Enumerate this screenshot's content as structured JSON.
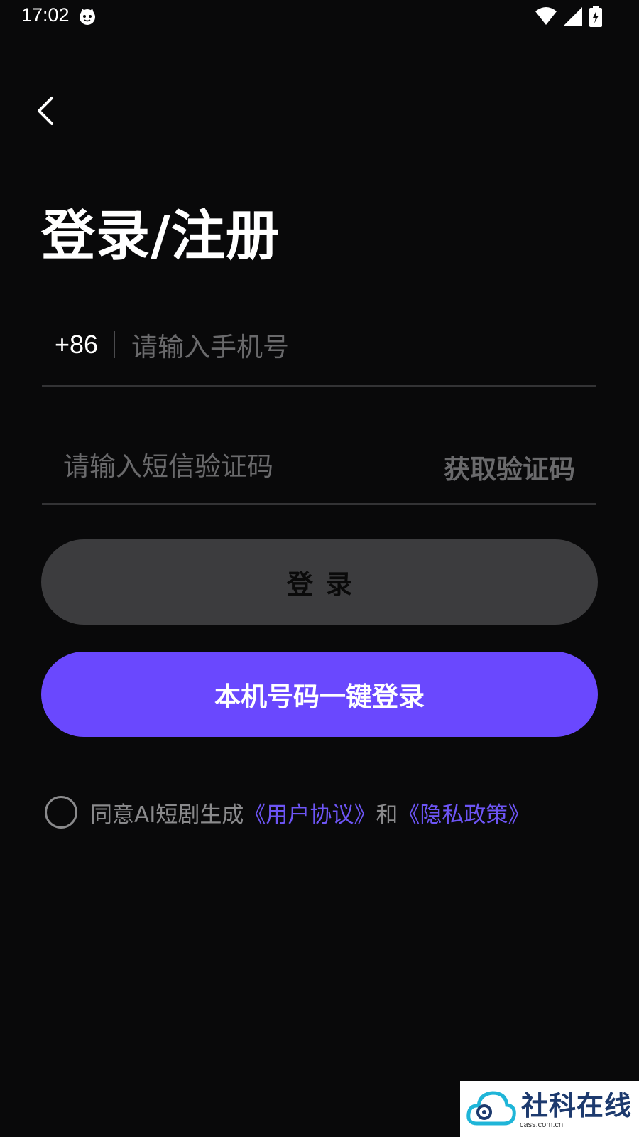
{
  "status_bar": {
    "time": "17:02"
  },
  "header": {
    "back_icon": "chevron-left-icon"
  },
  "title": "登录/注册",
  "phone_field": {
    "country_code": "+86",
    "placeholder": "请输入手机号",
    "value": ""
  },
  "code_field": {
    "placeholder": "请输入短信验证码",
    "value": "",
    "get_code_label": "获取验证码"
  },
  "buttons": {
    "login_label": "登录",
    "quick_login_label": "本机号码一键登录"
  },
  "agreement": {
    "prefix": "同意AI短剧生成",
    "user_agreement": "《用户协议》",
    "conjunction": "和",
    "privacy_policy": "《隐私政策》",
    "checked": false
  },
  "watermark": {
    "text": "社科在线",
    "sub": "cass.com.cn"
  },
  "colors": {
    "background": "#09090a",
    "accent": "#6a48fe",
    "link": "#6d55f5",
    "disabled_button": "#3c3c3e",
    "placeholder": "#6a6a6c"
  }
}
